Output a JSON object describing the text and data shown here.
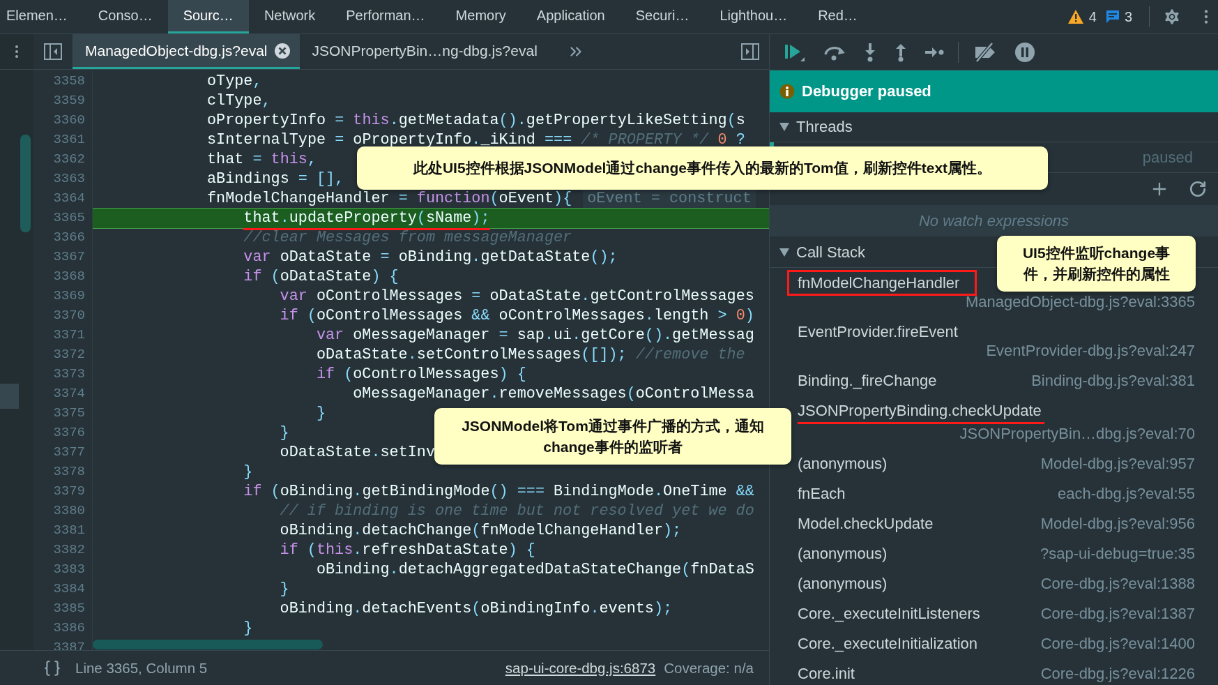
{
  "top_tabs": [
    {
      "label": "Elemen…",
      "selected": false
    },
    {
      "label": "Conso…",
      "selected": false
    },
    {
      "label": "Sourc…",
      "selected": true
    },
    {
      "label": "Network",
      "selected": false
    },
    {
      "label": "Performan…",
      "selected": false
    },
    {
      "label": "Memory",
      "selected": false
    },
    {
      "label": "Application",
      "selected": false
    },
    {
      "label": "Securi…",
      "selected": false
    },
    {
      "label": "Lighthou…",
      "selected": false
    },
    {
      "label": "Red…",
      "selected": false
    }
  ],
  "issue_counts": {
    "warnings": "4",
    "messages": "3"
  },
  "file_tabs": [
    {
      "label": "ManagedObject-dbg.js?eval",
      "selected": true,
      "closable": true
    },
    {
      "label": "JSONPropertyBin…ng-dbg.js?eval",
      "selected": false,
      "closable": false
    }
  ],
  "code": {
    "lines": [
      {
        "number": "3358",
        "current": false,
        "tokens": [
          {
            "kind": "id",
            "text": "oType"
          },
          {
            "kind": "op",
            "text": ","
          }
        ]
      },
      {
        "number": "3359",
        "current": false,
        "tokens": [
          {
            "kind": "id",
            "text": "clType"
          },
          {
            "kind": "op",
            "text": ","
          }
        ]
      },
      {
        "number": "3360",
        "current": false,
        "tokens": [
          {
            "kind": "id",
            "text": "oPropertyInfo "
          },
          {
            "kind": "op",
            "text": "= "
          },
          {
            "kind": "kw",
            "text": "this"
          },
          {
            "kind": "op",
            "text": "."
          },
          {
            "kind": "id",
            "text": "getMetadata"
          },
          {
            "kind": "op",
            "text": "()."
          },
          {
            "kind": "id",
            "text": "getPropertyLikeSetting"
          },
          {
            "kind": "op",
            "text": "("
          },
          {
            "kind": "id",
            "text": "s"
          }
        ]
      },
      {
        "number": "3361",
        "current": false,
        "tokens": [
          {
            "kind": "id",
            "text": "sInternalType "
          },
          {
            "kind": "op",
            "text": "= "
          },
          {
            "kind": "id",
            "text": "oPropertyInfo"
          },
          {
            "kind": "op",
            "text": "."
          },
          {
            "kind": "id",
            "text": "_iKind "
          },
          {
            "kind": "op",
            "text": "=== "
          },
          {
            "kind": "cm",
            "text": "/* PROPERTY */ "
          },
          {
            "kind": "num",
            "text": "0"
          },
          {
            "kind": "op",
            "text": " ?"
          }
        ]
      },
      {
        "number": "3362",
        "current": false,
        "tokens": [
          {
            "kind": "id",
            "text": "that "
          },
          {
            "kind": "op",
            "text": "= "
          },
          {
            "kind": "kw",
            "text": "this"
          },
          {
            "kind": "op",
            "text": ","
          }
        ]
      },
      {
        "number": "3363",
        "current": false,
        "tokens": [
          {
            "kind": "id",
            "text": "aBindings "
          },
          {
            "kind": "op",
            "text": "= [],"
          }
        ]
      },
      {
        "number": "3364",
        "current": false,
        "inline_value": "oEvent = construct",
        "tokens": [
          {
            "kind": "id",
            "text": "fnModelChangeHandler "
          },
          {
            "kind": "op",
            "text": "= "
          },
          {
            "kind": "kw",
            "text": "function"
          },
          {
            "kind": "op",
            "text": "("
          },
          {
            "kind": "id",
            "text": "oEvent"
          },
          {
            "kind": "op",
            "text": "){"
          }
        ],
        "children": [
          {
            "number": "3365",
            "current": true,
            "underlined": true,
            "tokens": [
              {
                "kind": "id",
                "text": "that"
              },
              {
                "kind": "op",
                "text": "."
              },
              {
                "kind": "id",
                "text": "updateProperty"
              },
              {
                "kind": "op",
                "text": "("
              },
              {
                "kind": "id",
                "text": "sName"
              },
              {
                "kind": "op",
                "text": ");"
              }
            ]
          },
          {
            "number": "3366",
            "current": false,
            "tokens": [
              {
                "kind": "cm",
                "text": "//clear Messages from messageManager"
              }
            ]
          },
          {
            "number": "3367",
            "current": false,
            "tokens": [
              {
                "kind": "kw",
                "text": "var "
              },
              {
                "kind": "id",
                "text": "oDataState "
              },
              {
                "kind": "op",
                "text": "= "
              },
              {
                "kind": "id",
                "text": "oBinding"
              },
              {
                "kind": "op",
                "text": "."
              },
              {
                "kind": "id",
                "text": "getDataState"
              },
              {
                "kind": "op",
                "text": "();"
              }
            ]
          },
          {
            "number": "3368",
            "current": false,
            "tokens": [
              {
                "kind": "kw",
                "text": "if "
              },
              {
                "kind": "op",
                "text": "("
              },
              {
                "kind": "id",
                "text": "oDataState"
              },
              {
                "kind": "op",
                "text": ") {"
              }
            ],
            "children": [
              {
                "number": "3369",
                "current": false,
                "tokens": [
                  {
                    "kind": "kw",
                    "text": "var "
                  },
                  {
                    "kind": "id",
                    "text": "oControlMessages "
                  },
                  {
                    "kind": "op",
                    "text": "= "
                  },
                  {
                    "kind": "id",
                    "text": "oDataState"
                  },
                  {
                    "kind": "op",
                    "text": "."
                  },
                  {
                    "kind": "id",
                    "text": "getControlMessages"
                  }
                ]
              },
              {
                "number": "3370",
                "current": false,
                "tokens": [
                  {
                    "kind": "kw",
                    "text": "if "
                  },
                  {
                    "kind": "op",
                    "text": "("
                  },
                  {
                    "kind": "id",
                    "text": "oControlMessages "
                  },
                  {
                    "kind": "op",
                    "text": "&& "
                  },
                  {
                    "kind": "id",
                    "text": "oControlMessages"
                  },
                  {
                    "kind": "op",
                    "text": "."
                  },
                  {
                    "kind": "id",
                    "text": "length "
                  },
                  {
                    "kind": "op",
                    "text": "> "
                  },
                  {
                    "kind": "num",
                    "text": "0"
                  },
                  {
                    "kind": "op",
                    "text": ")"
                  }
                ],
                "children": [
                  {
                    "number": "3371",
                    "current": false,
                    "tokens": [
                      {
                        "kind": "kw",
                        "text": "var "
                      },
                      {
                        "kind": "id",
                        "text": "oMessageManager "
                      },
                      {
                        "kind": "op",
                        "text": "= "
                      },
                      {
                        "kind": "id",
                        "text": "sap"
                      },
                      {
                        "kind": "op",
                        "text": "."
                      },
                      {
                        "kind": "id",
                        "text": "ui"
                      },
                      {
                        "kind": "op",
                        "text": "."
                      },
                      {
                        "kind": "id",
                        "text": "getCore"
                      },
                      {
                        "kind": "op",
                        "text": "()."
                      },
                      {
                        "kind": "id",
                        "text": "getMessag"
                      }
                    ]
                  },
                  {
                    "number": "3372",
                    "current": false,
                    "tokens": [
                      {
                        "kind": "id",
                        "text": "oDataState"
                      },
                      {
                        "kind": "op",
                        "text": "."
                      },
                      {
                        "kind": "id",
                        "text": "setControlMessages"
                      },
                      {
                        "kind": "op",
                        "text": "([]); "
                      },
                      {
                        "kind": "cm",
                        "text": "//remove the"
                      }
                    ]
                  },
                  {
                    "number": "3373",
                    "current": false,
                    "tokens": [
                      {
                        "kind": "kw",
                        "text": "if "
                      },
                      {
                        "kind": "op",
                        "text": "("
                      },
                      {
                        "kind": "id",
                        "text": "oControlMessages"
                      },
                      {
                        "kind": "op",
                        "text": ") {"
                      }
                    ],
                    "children": [
                      {
                        "number": "3374",
                        "current": false,
                        "tokens": [
                          {
                            "kind": "id",
                            "text": "oMessageManager"
                          },
                          {
                            "kind": "op",
                            "text": "."
                          },
                          {
                            "kind": "id",
                            "text": "removeMessages"
                          },
                          {
                            "kind": "op",
                            "text": "("
                          },
                          {
                            "kind": "id",
                            "text": "oControlMessa"
                          }
                        ]
                      }
                    ]
                  },
                  {
                    "number": "3375",
                    "current": false,
                    "tokens": [
                      {
                        "kind": "op",
                        "text": "}"
                      }
                    ]
                  }
                ]
              },
              {
                "number": "3376",
                "current": false,
                "tokens": [
                  {
                    "kind": "op",
                    "text": "}"
                  }
                ]
              },
              {
                "number": "3377",
                "current": false,
                "tokens": [
                  {
                    "kind": "id",
                    "text": "oDataState"
                  },
                  {
                    "kind": "op",
                    "text": "."
                  },
                  {
                    "kind": "id",
                    "text": "setInv"
                  }
                ]
              }
            ]
          },
          {
            "number": "3378",
            "current": false,
            "tokens": [
              {
                "kind": "op",
                "text": "}"
              }
            ]
          },
          {
            "number": "3379",
            "current": false,
            "tokens": [
              {
                "kind": "kw",
                "text": "if "
              },
              {
                "kind": "op",
                "text": "("
              },
              {
                "kind": "id",
                "text": "oBinding"
              },
              {
                "kind": "op",
                "text": "."
              },
              {
                "kind": "id",
                "text": "getBindingMode"
              },
              {
                "kind": "op",
                "text": "() === "
              },
              {
                "kind": "id",
                "text": "BindingMode"
              },
              {
                "kind": "op",
                "text": "."
              },
              {
                "kind": "id",
                "text": "OneTime "
              },
              {
                "kind": "op",
                "text": "&&"
              }
            ],
            "children": [
              {
                "number": "3380",
                "current": false,
                "tokens": [
                  {
                    "kind": "cm",
                    "text": "// if binding is one time but not resolved yet we do"
                  }
                ]
              },
              {
                "number": "3381",
                "current": false,
                "tokens": [
                  {
                    "kind": "id",
                    "text": "oBinding"
                  },
                  {
                    "kind": "op",
                    "text": "."
                  },
                  {
                    "kind": "id",
                    "text": "detachChange"
                  },
                  {
                    "kind": "op",
                    "text": "("
                  },
                  {
                    "kind": "id",
                    "text": "fnModelChangeHandler"
                  },
                  {
                    "kind": "op",
                    "text": ");"
                  }
                ]
              },
              {
                "number": "3382",
                "current": false,
                "tokens": [
                  {
                    "kind": "kw",
                    "text": "if "
                  },
                  {
                    "kind": "op",
                    "text": "("
                  },
                  {
                    "kind": "kw",
                    "text": "this"
                  },
                  {
                    "kind": "op",
                    "text": "."
                  },
                  {
                    "kind": "id",
                    "text": "refreshDataState"
                  },
                  {
                    "kind": "op",
                    "text": ") {"
                  }
                ],
                "children": [
                  {
                    "number": "3383",
                    "current": false,
                    "tokens": [
                      {
                        "kind": "id",
                        "text": "oBinding"
                      },
                      {
                        "kind": "op",
                        "text": "."
                      },
                      {
                        "kind": "id",
                        "text": "detachAggregatedDataStateChange"
                      },
                      {
                        "kind": "op",
                        "text": "("
                      },
                      {
                        "kind": "id",
                        "text": "fnDataS"
                      }
                    ]
                  }
                ]
              },
              {
                "number": "3384",
                "current": false,
                "tokens": [
                  {
                    "kind": "op",
                    "text": "}"
                  }
                ]
              },
              {
                "number": "3385",
                "current": false,
                "tokens": [
                  {
                    "kind": "id",
                    "text": "oBinding"
                  },
                  {
                    "kind": "op",
                    "text": "."
                  },
                  {
                    "kind": "id",
                    "text": "detachEvents"
                  },
                  {
                    "kind": "op",
                    "text": "("
                  },
                  {
                    "kind": "id",
                    "text": "oBindingInfo"
                  },
                  {
                    "kind": "op",
                    "text": "."
                  },
                  {
                    "kind": "id",
                    "text": "events"
                  },
                  {
                    "kind": "op",
                    "text": ");"
                  }
                ]
              }
            ]
          },
          {
            "number": "3386",
            "current": false,
            "tokens": [
              {
                "kind": "op",
                "text": "}"
              }
            ]
          }
        ]
      },
      {
        "number": "3387",
        "current": false
      }
    ]
  },
  "status_bar": {
    "position": "Line 3365, Column 5",
    "link": "sap-ui-core-dbg.js:6873",
    "coverage": "Coverage: n/a"
  },
  "debugger": {
    "banner": "Debugger paused",
    "threads": {
      "title": "Threads",
      "expanded": true,
      "rows": [
        {
          "status": "paused",
          "selected": true
        }
      ]
    },
    "watch": {
      "empty_text": "No watch expressions"
    },
    "call_stack": {
      "title": "Call Stack",
      "expanded": true,
      "frames": [
        {
          "name": "fnModelChangeHandler",
          "location": "ManagedObject-dbg.js?eval:3365",
          "boxed": true
        },
        {
          "name": "EventProvider.fireEvent",
          "location": "EventProvider-dbg.js?eval:247"
        },
        {
          "name": "Binding._fireChange",
          "location": "Binding-dbg.js?eval:381"
        },
        {
          "name": "JSONPropertyBinding.checkUpdate",
          "location": "JSONPropertyBin…dbg.js?eval:70",
          "underlined": true
        },
        {
          "name": "(anonymous)",
          "location": "Model-dbg.js?eval:957"
        },
        {
          "name": "fnEach",
          "location": "each-dbg.js?eval:55"
        },
        {
          "name": "Model.checkUpdate",
          "location": "Model-dbg.js?eval:956"
        },
        {
          "name": "(anonymous)",
          "location": "?sap-ui-debug=true:35"
        },
        {
          "name": "(anonymous)",
          "location": "Core-dbg.js?eval:1388"
        },
        {
          "name": "Core._executeInitListeners",
          "location": "Core-dbg.js?eval:1387"
        },
        {
          "name": "Core._executeInitialization",
          "location": "Core-dbg.js?eval:1400"
        },
        {
          "name": "Core.init",
          "location": "Core-dbg.js?eval:1226"
        }
      ]
    }
  },
  "annotations": [
    {
      "kind": "callout",
      "text": "此处UI5控件根据JSONModel通过change事件传入的最新的Tom值，刷新控件text属性。"
    },
    {
      "kind": "callout",
      "text": "UI5控件监听change事件，并刷新控件的属性"
    },
    {
      "kind": "callout",
      "text": "JSONModel将Tom通过事件广播的方式，通知change事件的监听者"
    }
  ]
}
